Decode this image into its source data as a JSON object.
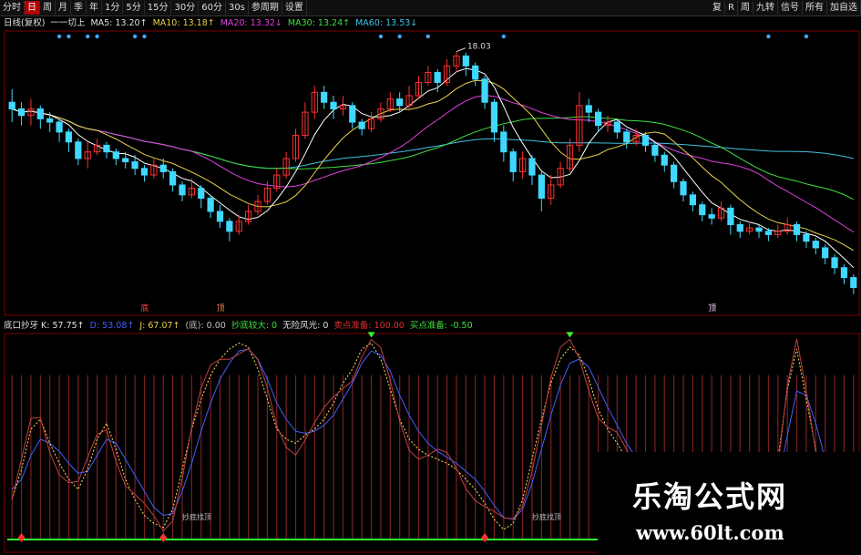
{
  "toolbar": {
    "left": [
      "分时",
      "日",
      "周",
      "月",
      "季",
      "年",
      "1分",
      "5分",
      "15分",
      "30分",
      "60分",
      "30s",
      "参周期",
      "设置"
    ],
    "active_index": 1,
    "right": [
      "复",
      "R",
      "周",
      "九转",
      "信号",
      "所有",
      "加自选"
    ]
  },
  "ma_legend": [
    {
      "text": "日线(复权)",
      "color": "#e0e0e0"
    },
    {
      "text": "一一切上",
      "color": "#e0e0e0"
    },
    {
      "text": "MA5: 13.20↑",
      "color": "#e0e0e0"
    },
    {
      "text": "MA10: 13.18↑",
      "color": "#e8d24a"
    },
    {
      "text": "MA20: 13.32↓",
      "color": "#e040e0"
    },
    {
      "text": "MA30: 13.24↑",
      "color": "#40e040"
    },
    {
      "text": "MA60: 13.53↓",
      "color": "#40c0e0"
    }
  ],
  "indicator_legend": [
    {
      "text": "底口抄牙 K: 57.75↑",
      "color": "#e0e0e0"
    },
    {
      "text": "D: 53.08↑",
      "color": "#4060ff"
    },
    {
      "text": "J: 67.07↑",
      "color": "#e8d24a"
    },
    {
      "text": "(底): 0.00",
      "color": "#c0c0c0"
    },
    {
      "text": "抄底较大: 0",
      "color": "#40e040"
    },
    {
      "text": "无险风光: 0",
      "color": "#e0e0e0"
    },
    {
      "text": "卖点准备: 100.00",
      "color": "#e03030"
    },
    {
      "text": "买点准备: -0.50",
      "color": "#40e040"
    }
  ],
  "price_annotation": "18.03",
  "marker_labels": [
    "底",
    "顶",
    "顶"
  ],
  "dip_labels": [
    "抄底找顶",
    "抄底找顶"
  ],
  "watermark": {
    "title": "乐淘公式网",
    "url": "www.60lt.com"
  },
  "colors": {
    "up": "#ff3030",
    "down": "#40d8ff",
    "ma5": "#ffffff",
    "ma10": "#e8d24a",
    "ma20": "#e040e0",
    "ma30": "#40e040",
    "ma60": "#40c0e0"
  },
  "chart_data": {
    "type": "candlestick",
    "ylim": [
      10.5,
      18.6
    ],
    "candles": [
      [
        16.5,
        16.3,
        16.9,
        15.9
      ],
      [
        16.3,
        16.1,
        16.5,
        15.8
      ],
      [
        16.1,
        16.3,
        16.6,
        15.8
      ],
      [
        16.3,
        16.0,
        16.4,
        15.7
      ],
      [
        16.0,
        15.9,
        16.2,
        15.6
      ],
      [
        15.9,
        15.6,
        16.0,
        15.3
      ],
      [
        15.6,
        15.3,
        15.7,
        15.0
      ],
      [
        15.3,
        14.8,
        15.4,
        14.6
      ],
      [
        14.8,
        15.0,
        15.3,
        14.5
      ],
      [
        15.0,
        15.2,
        15.4,
        14.9
      ],
      [
        15.2,
        15.0,
        15.3,
        14.8
      ],
      [
        15.0,
        14.8,
        15.1,
        14.6
      ],
      [
        14.8,
        14.7,
        15.0,
        14.5
      ],
      [
        14.7,
        14.5,
        14.9,
        14.3
      ],
      [
        14.5,
        14.3,
        14.6,
        14.1
      ],
      [
        14.3,
        14.6,
        14.8,
        14.2
      ],
      [
        14.6,
        14.4,
        14.8,
        14.2
      ],
      [
        14.4,
        14.0,
        14.5,
        13.8
      ],
      [
        14.0,
        13.7,
        14.1,
        13.5
      ],
      [
        13.7,
        13.9,
        14.2,
        13.6
      ],
      [
        13.9,
        13.6,
        14.0,
        13.3
      ],
      [
        13.6,
        13.2,
        13.7,
        13.0
      ],
      [
        13.2,
        12.9,
        13.4,
        12.7
      ],
      [
        12.9,
        12.6,
        13.0,
        12.3
      ],
      [
        12.6,
        12.9,
        13.1,
        12.5
      ],
      [
        12.9,
        13.2,
        13.4,
        12.8
      ],
      [
        13.2,
        13.5,
        13.7,
        13.1
      ],
      [
        13.5,
        13.9,
        14.1,
        13.4
      ],
      [
        13.9,
        14.3,
        14.5,
        13.8
      ],
      [
        14.3,
        14.8,
        15.0,
        14.2
      ],
      [
        14.8,
        15.5,
        15.7,
        14.7
      ],
      [
        15.5,
        16.2,
        16.5,
        15.4
      ],
      [
        16.2,
        16.8,
        17.0,
        16.0
      ],
      [
        16.8,
        16.5,
        17.0,
        16.3
      ],
      [
        16.5,
        16.3,
        16.7,
        16.0
      ],
      [
        16.3,
        16.4,
        16.7,
        16.1
      ],
      [
        16.4,
        15.9,
        16.5,
        15.7
      ],
      [
        15.9,
        15.7,
        16.0,
        15.5
      ],
      [
        15.7,
        16.0,
        16.2,
        15.6
      ],
      [
        16.0,
        16.3,
        16.5,
        15.9
      ],
      [
        16.3,
        16.6,
        16.8,
        16.2
      ],
      [
        16.6,
        16.4,
        16.8,
        16.2
      ],
      [
        16.4,
        16.7,
        17.0,
        16.3
      ],
      [
        16.7,
        17.1,
        17.3,
        16.6
      ],
      [
        17.1,
        17.4,
        17.6,
        17.0
      ],
      [
        17.4,
        17.1,
        17.5,
        16.8
      ],
      [
        17.1,
        17.6,
        17.8,
        17.0
      ],
      [
        17.6,
        17.9,
        18.03,
        17.4
      ],
      [
        17.9,
        17.6,
        18.0,
        17.3
      ],
      [
        17.6,
        17.2,
        17.7,
        17.0
      ],
      [
        17.2,
        16.5,
        17.3,
        16.3
      ],
      [
        16.5,
        15.6,
        16.6,
        15.3
      ],
      [
        15.6,
        15.0,
        15.8,
        14.7
      ],
      [
        15.0,
        14.4,
        15.1,
        14.1
      ],
      [
        14.4,
        14.8,
        15.0,
        14.2
      ],
      [
        14.8,
        14.3,
        14.9,
        14.0
      ],
      [
        14.3,
        13.6,
        14.4,
        13.2
      ],
      [
        13.6,
        14.0,
        14.3,
        13.4
      ],
      [
        14.0,
        14.5,
        14.7,
        13.9
      ],
      [
        14.5,
        15.2,
        15.4,
        14.4
      ],
      [
        15.2,
        16.4,
        16.8,
        15.0
      ],
      [
        16.4,
        16.2,
        16.6,
        15.9
      ],
      [
        16.2,
        15.8,
        16.3,
        15.6
      ],
      [
        15.8,
        15.9,
        16.1,
        15.6
      ],
      [
        15.9,
        15.6,
        16.0,
        15.4
      ],
      [
        15.6,
        15.3,
        15.7,
        15.1
      ],
      [
        15.3,
        15.5,
        15.7,
        15.2
      ],
      [
        15.5,
        15.2,
        15.6,
        15.0
      ],
      [
        15.2,
        14.9,
        15.3,
        14.7
      ],
      [
        14.9,
        14.6,
        15.0,
        14.4
      ],
      [
        14.6,
        14.1,
        14.7,
        13.9
      ],
      [
        14.1,
        13.7,
        14.2,
        13.5
      ],
      [
        13.7,
        13.4,
        13.8,
        13.2
      ],
      [
        13.4,
        13.1,
        13.5,
        12.9
      ],
      [
        13.1,
        13.0,
        13.3,
        12.8
      ],
      [
        13.0,
        13.3,
        13.5,
        12.9
      ],
      [
        13.3,
        12.8,
        13.4,
        12.5
      ],
      [
        12.8,
        12.6,
        12.9,
        12.4
      ],
      [
        12.6,
        12.7,
        12.9,
        12.5
      ],
      [
        12.7,
        12.6,
        12.8,
        12.4
      ],
      [
        12.6,
        12.5,
        12.7,
        12.3
      ],
      [
        12.5,
        12.6,
        12.8,
        12.4
      ],
      [
        12.6,
        12.8,
        13.0,
        12.5
      ],
      [
        12.8,
        12.5,
        12.9,
        12.3
      ],
      [
        12.5,
        12.3,
        12.6,
        12.1
      ],
      [
        12.3,
        12.1,
        12.4,
        11.9
      ],
      [
        12.1,
        11.8,
        12.2,
        11.6
      ],
      [
        11.8,
        11.5,
        11.9,
        11.3
      ],
      [
        11.5,
        11.2,
        11.6,
        11.0
      ],
      [
        11.2,
        10.9,
        11.3,
        10.7
      ]
    ],
    "oscillator": {
      "ylim": [
        0,
        100
      ],
      "K": [
        20,
        35,
        55,
        60,
        48,
        38,
        30,
        25,
        35,
        50,
        58,
        45,
        30,
        20,
        12,
        8,
        6,
        15,
        35,
        55,
        70,
        82,
        90,
        95,
        98,
        96,
        85,
        70,
        55,
        50,
        48,
        52,
        55,
        60,
        68,
        78,
        85,
        95,
        98,
        90,
        75,
        60,
        50,
        45,
        42,
        40,
        38,
        35,
        30,
        25,
        18,
        10,
        5,
        8,
        20,
        40,
        60,
        78,
        90,
        96,
        92,
        80,
        65,
        55,
        48,
        40,
        35,
        30,
        28,
        26,
        24,
        22,
        24,
        20,
        18,
        16,
        15,
        14,
        15,
        16,
        18,
        40,
        75,
        95,
        70,
        45,
        25,
        12,
        8,
        6
      ],
      "D": [
        25,
        30,
        42,
        50,
        48,
        44,
        38,
        33,
        34,
        42,
        50,
        48,
        40,
        32,
        24,
        16,
        12,
        13,
        24,
        38,
        54,
        68,
        80,
        88,
        94,
        95,
        90,
        80,
        68,
        60,
        54,
        53,
        54,
        57,
        62,
        70,
        78,
        88,
        94,
        92,
        84,
        72,
        62,
        54,
        48,
        44,
        41,
        38,
        34,
        30,
        24,
        17,
        11,
        10,
        15,
        28,
        45,
        62,
        77,
        88,
        90,
        86,
        76,
        66,
        57,
        48,
        41,
        35,
        31,
        28,
        26,
        24,
        24,
        22,
        20,
        18,
        17,
        16,
        16,
        16,
        17,
        28,
        52,
        74,
        72,
        58,
        40,
        26,
        17,
        11
      ]
    }
  }
}
